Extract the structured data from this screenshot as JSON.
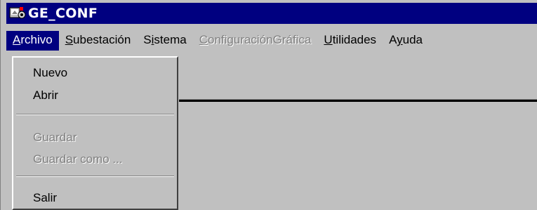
{
  "window": {
    "title": "GE_CONF"
  },
  "menubar": {
    "items": [
      {
        "label": "Archivo",
        "underline": "A",
        "rest": "rchivo",
        "state": "active"
      },
      {
        "label": "Subestación",
        "underline": "S",
        "rest": "ubestación",
        "state": "normal"
      },
      {
        "label": "Sistema",
        "pre": "S",
        "underline": "i",
        "rest": "stema",
        "state": "normal"
      },
      {
        "label": "ConfiguraciónGráfica",
        "underline": "C",
        "rest": "onfiguraciónGráfica",
        "state": "disabled"
      },
      {
        "label": "Utilidades",
        "underline": "U",
        "rest": "tilidades",
        "state": "normal"
      },
      {
        "label": "Ayuda",
        "pre": "A",
        "underline": "y",
        "rest": "uda",
        "state": "normal"
      }
    ]
  },
  "archivo_menu": {
    "items": [
      {
        "label": "Nuevo",
        "enabled": true
      },
      {
        "label": "Abrir",
        "enabled": true
      },
      {
        "label": "Guardar",
        "enabled": false
      },
      {
        "label": "Guardar como ...",
        "enabled": false
      },
      {
        "label": "Salir",
        "enabled": true
      }
    ]
  },
  "colors": {
    "titlebar": "#000080",
    "face": "#c0c0c0",
    "disabled_text": "#808080"
  }
}
